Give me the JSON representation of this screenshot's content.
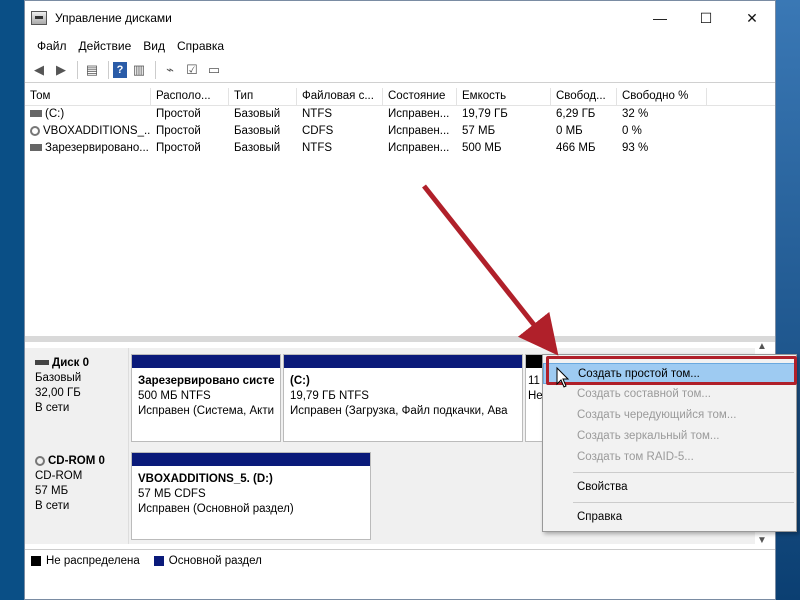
{
  "window": {
    "title": "Управление дисками"
  },
  "menu": [
    "Файл",
    "Действие",
    "Вид",
    "Справка"
  ],
  "volumes": {
    "headers": [
      "Том",
      "Располо...",
      "Тип",
      "Файловая с...",
      "Состояние",
      "Емкость",
      "Свобод...",
      "Свободно %"
    ],
    "rows": [
      {
        "name": "(C:)",
        "layout": "Простой",
        "type": "Базовый",
        "fs": "NTFS",
        "status": "Исправен...",
        "capacity": "19,79 ГБ",
        "free": "6,29 ГБ",
        "free_pct": "32 %"
      },
      {
        "name": "VBOXADDITIONS_...",
        "layout": "Простой",
        "type": "Базовый",
        "fs": "CDFS",
        "status": "Исправен...",
        "capacity": "57 МБ",
        "free": "0 МБ",
        "free_pct": "0 %"
      },
      {
        "name": "Зарезервировано...",
        "layout": "Простой",
        "type": "Базовый",
        "fs": "NTFS",
        "status": "Исправен...",
        "capacity": "500 МБ",
        "free": "466 МБ",
        "free_pct": "93 %"
      }
    ]
  },
  "disks": {
    "disk0": {
      "name": "Диск 0",
      "type": "Базовый",
      "size": "32,00 ГБ",
      "status": "В сети",
      "parts": [
        {
          "name": "Зарезервировано систе",
          "info": "500 МБ NTFS",
          "status": "Исправен (Система, Акти"
        },
        {
          "name": "(C:)",
          "info": "19,79 ГБ NTFS",
          "status": "Исправен (Загрузка, Файл подкачки, Ава"
        },
        {
          "name": "",
          "info": "11",
          "status": "Не"
        }
      ]
    },
    "cdrom0": {
      "name": "CD-ROM 0",
      "type": "CD-ROM",
      "size": "57 МБ",
      "status": "В сети",
      "parts": [
        {
          "name": "VBOXADDITIONS_5.  (D:)",
          "info": "57 МБ CDFS",
          "status": "Исправен (Основной раздел)"
        }
      ]
    }
  },
  "context_menu": [
    {
      "label": "Создать простой том...",
      "enabled": true
    },
    {
      "label": "Создать составной том...",
      "enabled": false
    },
    {
      "label": "Создать чередующийся том...",
      "enabled": false
    },
    {
      "label": "Создать зеркальный том...",
      "enabled": false
    },
    {
      "label": "Создать том RAID-5...",
      "enabled": false
    },
    {
      "label": "Свойства",
      "enabled": true
    },
    {
      "label": "Справка",
      "enabled": true
    }
  ],
  "legend": [
    {
      "label": "Не распределена",
      "color": "#000000"
    },
    {
      "label": "Основной раздел",
      "color": "#0a1a7a"
    }
  ],
  "colors": {
    "accent_highlight": "#b0202a",
    "partition_bar": "#0a1a7a",
    "selected_item": "#9ecbf2"
  },
  "icons": {
    "back": "arrow-left-icon",
    "forward": "arrow-right-icon",
    "help": "help-icon"
  }
}
